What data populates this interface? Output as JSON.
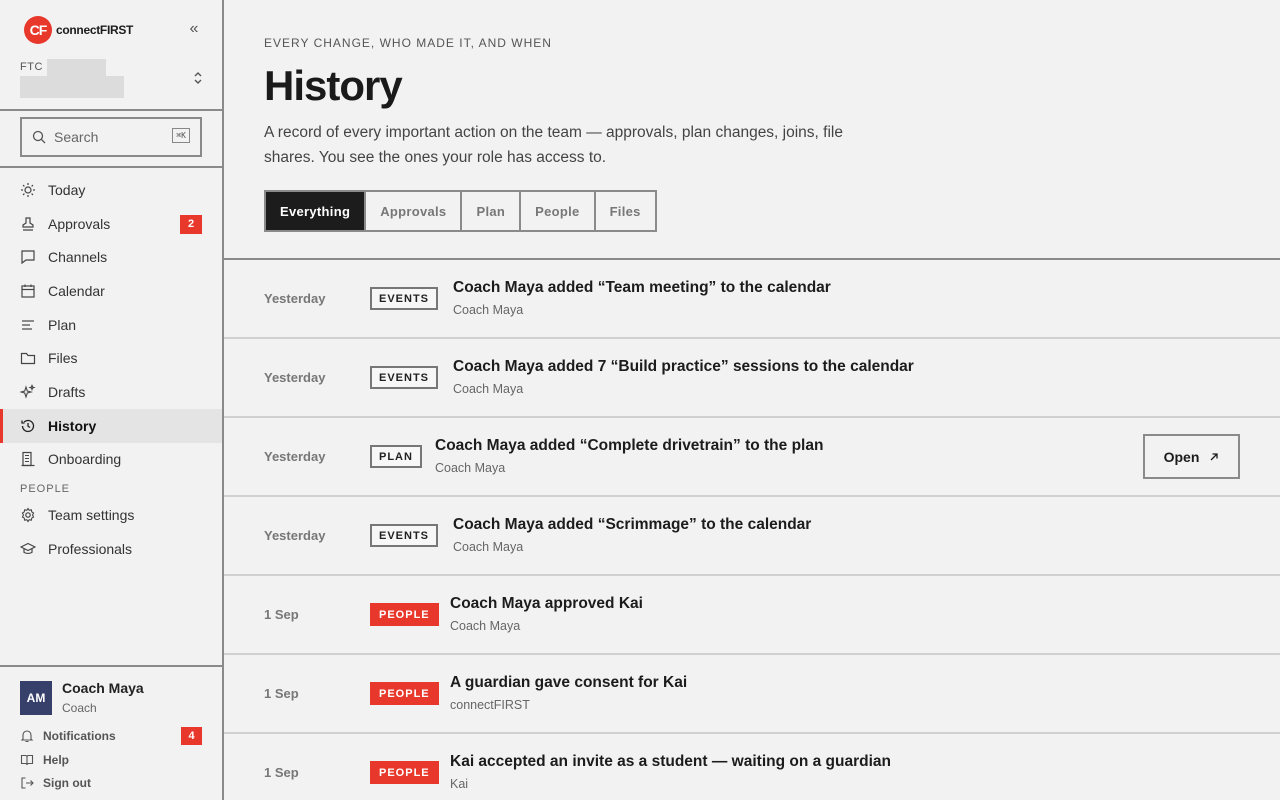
{
  "brand": {
    "logo_text": "CF",
    "name": "connectFIRST"
  },
  "team": {
    "prefix": "FTC"
  },
  "search": {
    "placeholder": "Search",
    "shortcut": "⌘K"
  },
  "nav": {
    "items": [
      {
        "label": "Today",
        "icon": "sun-icon"
      },
      {
        "label": "Approvals",
        "icon": "stamp-icon",
        "badge": "2"
      },
      {
        "label": "Channels",
        "icon": "chat-icon"
      },
      {
        "label": "Calendar",
        "icon": "calendar-icon"
      },
      {
        "label": "Plan",
        "icon": "plan-icon"
      },
      {
        "label": "Files",
        "icon": "folder-icon"
      },
      {
        "label": "Drafts",
        "icon": "sparkle-icon"
      },
      {
        "label": "History",
        "icon": "history-icon",
        "active": true
      },
      {
        "label": "Onboarding",
        "icon": "building-icon"
      }
    ],
    "section_people": "PEOPLE",
    "people_items": [
      {
        "label": "Team settings",
        "icon": "gear-icon"
      },
      {
        "label": "Professionals",
        "icon": "graduation-cap-icon"
      }
    ]
  },
  "user": {
    "initials": "AM",
    "name": "Coach Maya",
    "role": "Coach",
    "notifications_label": "Notifications",
    "notifications_badge": "4",
    "help_label": "Help",
    "signout_label": "Sign out"
  },
  "page": {
    "eyebrow": "EVERY CHANGE, WHO MADE IT, AND WHEN",
    "title": "History",
    "description": "A record of every important action on the team — approvals, plan changes, joins, file shares. You see the ones your role has access to."
  },
  "tabs": [
    "Everything",
    "Approvals",
    "Plan",
    "People",
    "Files"
  ],
  "events": [
    {
      "date": "Yesterday",
      "tag": "EVENTS",
      "title": "Coach Maya added “Team meeting” to the calendar",
      "actor": "Coach Maya"
    },
    {
      "date": "Yesterday",
      "tag": "EVENTS",
      "title": "Coach Maya added 7 “Build practice” sessions to the calendar",
      "actor": "Coach Maya"
    },
    {
      "date": "Yesterday",
      "tag": "PLAN",
      "title": "Coach Maya added “Complete drivetrain” to the plan",
      "actor": "Coach Maya",
      "action": "Open"
    },
    {
      "date": "Yesterday",
      "tag": "EVENTS",
      "title": "Coach Maya added “Scrimmage” to the calendar",
      "actor": "Coach Maya"
    },
    {
      "date": "1 Sep",
      "tag": "PEOPLE",
      "title": "Coach Maya approved Kai",
      "actor": "Coach Maya"
    },
    {
      "date": "1 Sep",
      "tag": "PEOPLE",
      "title": "A guardian gave consent for Kai",
      "actor": "connectFIRST"
    },
    {
      "date": "1 Sep",
      "tag": "PEOPLE",
      "title": "Kai accepted an invite as a student — waiting on a guardian",
      "actor": "Kai"
    }
  ],
  "colors": {
    "accent": "#e8372b",
    "avatar": "#36406b",
    "active_tab": "#1c1c1c"
  }
}
